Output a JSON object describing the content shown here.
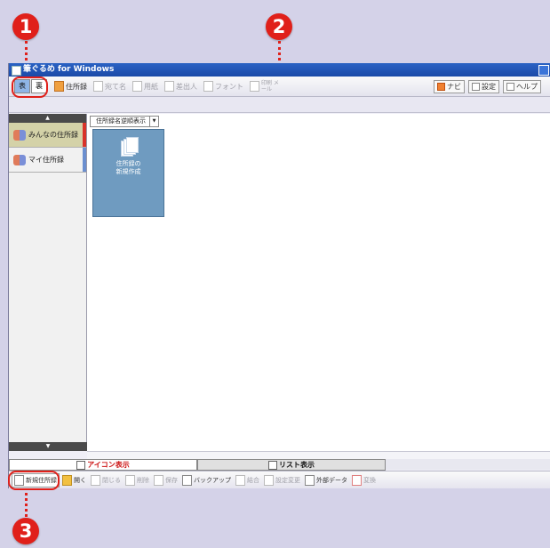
{
  "callouts": [
    "1",
    "2",
    "3"
  ],
  "window": {
    "title": "筆ぐるめ for Windows"
  },
  "toolbar": {
    "face_front": "表",
    "face_back": "裏",
    "items": [
      {
        "label": "住所録",
        "enabled": true
      },
      {
        "label": "宛て名",
        "enabled": false
      },
      {
        "label": "用紙",
        "enabled": false
      },
      {
        "label": "差出人",
        "enabled": false
      },
      {
        "label": "フォント",
        "enabled": false
      },
      {
        "label": "印刷 メール",
        "enabled": false
      }
    ],
    "right_items": [
      "ナビ",
      "設定",
      "ヘルプ"
    ]
  },
  "sidebar": {
    "items": [
      {
        "label": "みんなの住所録",
        "active": true,
        "bar_color": "#d8332a"
      },
      {
        "label": "マイ住所録",
        "active": false,
        "bar_color": "#6b8fd0"
      }
    ]
  },
  "main": {
    "sort_label": "住所録名逆順表示",
    "tile_label_line1": "住所録の",
    "tile_label_line2": "新規作成"
  },
  "tabs": {
    "icon_view": "アイコン表示",
    "list_view": "リスト表示"
  },
  "bottombar": {
    "items": [
      {
        "label": "新規住所録",
        "enabled": true
      },
      {
        "label": "開く",
        "enabled": true
      },
      {
        "label": "閉じる",
        "enabled": false
      },
      {
        "label": "削除",
        "enabled": false
      },
      {
        "label": "保存",
        "enabled": false
      },
      {
        "label": "バックアップ",
        "enabled": true
      },
      {
        "label": "結合",
        "enabled": false
      },
      {
        "label": "設定変更",
        "enabled": false
      },
      {
        "label": "外部データ",
        "enabled": true
      },
      {
        "label": "変換",
        "enabled": false
      }
    ]
  }
}
